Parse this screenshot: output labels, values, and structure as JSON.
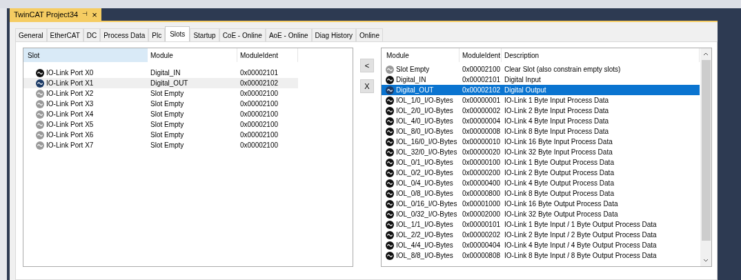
{
  "document_tab": {
    "title": "TwinCAT Project34",
    "pin": "⊣",
    "close": "×"
  },
  "tabs": [
    {
      "label": "General",
      "selected": false
    },
    {
      "label": "EtherCAT",
      "selected": false
    },
    {
      "label": "DC",
      "selected": false
    },
    {
      "label": "Process Data",
      "selected": false
    },
    {
      "label": "Plc",
      "selected": false
    },
    {
      "label": "Slots",
      "selected": true
    },
    {
      "label": "Startup",
      "selected": false
    },
    {
      "label": "CoE - Online",
      "selected": false
    },
    {
      "label": "AoE - Online",
      "selected": false
    },
    {
      "label": "Diag History",
      "selected": false
    },
    {
      "label": "Online",
      "selected": false
    }
  ],
  "slots_table": {
    "columns": [
      "Slot",
      "Module",
      "ModuleIdent"
    ],
    "rows": [
      {
        "slot": "IO-Link Port X0",
        "module": "Digital_IN",
        "ident": "0x00002101",
        "kind": "module",
        "selected": false
      },
      {
        "slot": "IO-Link Port X1",
        "module": "Digital_OUT",
        "ident": "0x00002102",
        "kind": "module",
        "selected": true
      },
      {
        "slot": "IO-Link Port X2",
        "module": "Slot Empty",
        "ident": "0x00002100",
        "kind": "empty",
        "selected": false
      },
      {
        "slot": "IO-Link Port X3",
        "module": "Slot Empty",
        "ident": "0x00002100",
        "kind": "empty",
        "selected": false
      },
      {
        "slot": "IO-Link Port X4",
        "module": "Slot Empty",
        "ident": "0x00002100",
        "kind": "empty",
        "selected": false
      },
      {
        "slot": "IO-Link Port X5",
        "module": "Slot Empty",
        "ident": "0x00002100",
        "kind": "empty",
        "selected": false
      },
      {
        "slot": "IO-Link Port X6",
        "module": "Slot Empty",
        "ident": "0x00002100",
        "kind": "empty",
        "selected": false
      },
      {
        "slot": "IO-Link Port X7",
        "module": "Slot Empty",
        "ident": "0x00002100",
        "kind": "empty",
        "selected": false
      }
    ]
  },
  "buttons": [
    "<",
    "X"
  ],
  "modules_table": {
    "columns": [
      "Module",
      "ModuleIdent",
      "Description"
    ],
    "rows": [
      {
        "module": "Slot Empty",
        "ident": "0x00002100",
        "description": "Clear Slot (also constrain empty slots)",
        "kind": "empty",
        "selected": false
      },
      {
        "module": "Digital_IN",
        "ident": "0x00002101",
        "description": "Digital Input",
        "kind": "module",
        "selected": false
      },
      {
        "module": "Digital_OUT",
        "ident": "0x00002102",
        "description": "Digital Output",
        "kind": "module",
        "selected": true
      },
      {
        "module": "IOL_1/0_I/O-Bytes",
        "ident": "0x00000001",
        "description": "IO-Link 1 Byte Input Process Data",
        "kind": "module",
        "selected": false
      },
      {
        "module": "IOL_2/0_I/O-Bytes",
        "ident": "0x00000002",
        "description": "IO-Link 2 Byte Input Process Data",
        "kind": "module",
        "selected": false
      },
      {
        "module": "IOL_4/0_I/O-Bytes",
        "ident": "0x00000004",
        "description": "IO-Link 4 Byte Input Process Data",
        "kind": "module",
        "selected": false
      },
      {
        "module": "IOL_8/0_I/O-Bytes",
        "ident": "0x00000008",
        "description": "IO-Link 8 Byte Input Process Data",
        "kind": "module",
        "selected": false
      },
      {
        "module": "IOL_16/0_I/O-Bytes",
        "ident": "0x00000010",
        "description": "IO-Link 16 Byte Input Process Data",
        "kind": "module",
        "selected": false
      },
      {
        "module": "IOL_32/0_I/O-Bytes",
        "ident": "0x00000020",
        "description": "IO-Link 32 Byte Input Process Data",
        "kind": "module",
        "selected": false
      },
      {
        "module": "IOL_0/1_I/O-Bytes",
        "ident": "0x00000100",
        "description": "IO-Link 1 Byte Output Process Data",
        "kind": "module",
        "selected": false
      },
      {
        "module": "IOL_0/2_I/O-Bytes",
        "ident": "0x00000200",
        "description": "IO-Link 2 Byte Output Process Data",
        "kind": "module",
        "selected": false
      },
      {
        "module": "IOL_0/4_I/O-Bytes",
        "ident": "0x00000400",
        "description": "IO-Link 4 Byte Output Process Data",
        "kind": "module",
        "selected": false
      },
      {
        "module": "IOL_0/8_I/O-Bytes",
        "ident": "0x00000800",
        "description": "IO-Link 8 Byte Output Process Data",
        "kind": "module",
        "selected": false
      },
      {
        "module": "IOL_0/16_I/O-Bytes",
        "ident": "0x00001000",
        "description": "IO-Link 16 Byte Output Process Data",
        "kind": "module",
        "selected": false
      },
      {
        "module": "IOL_0/32_I/O-Bytes",
        "ident": "0x00002000",
        "description": "IO-Link 32 Byte Output Process Data",
        "kind": "module",
        "selected": false
      },
      {
        "module": "IOL_1/1_I/O-Bytes",
        "ident": "0x00000101",
        "description": "IO-Link 1 Byte Input / 1 Byte Output Process Data",
        "kind": "module",
        "selected": false
      },
      {
        "module": "IOL_2/2_I/O-Bytes",
        "ident": "0x00000202",
        "description": "IO-Link 2 Byte Input / 2 Byte Output Process Data",
        "kind": "module",
        "selected": false
      },
      {
        "module": "IOL_4/4_I/O-Bytes",
        "ident": "0x00000404",
        "description": "IO-Link 4 Byte Input / 4 Byte Output Process Data",
        "kind": "module",
        "selected": false
      },
      {
        "module": "IOL_8/8_I/O-Bytes",
        "ident": "0x00000808",
        "description": "IO-Link 8 Byte Input / 8 Byte Output Process Data",
        "kind": "module",
        "selected": false
      }
    ]
  }
}
